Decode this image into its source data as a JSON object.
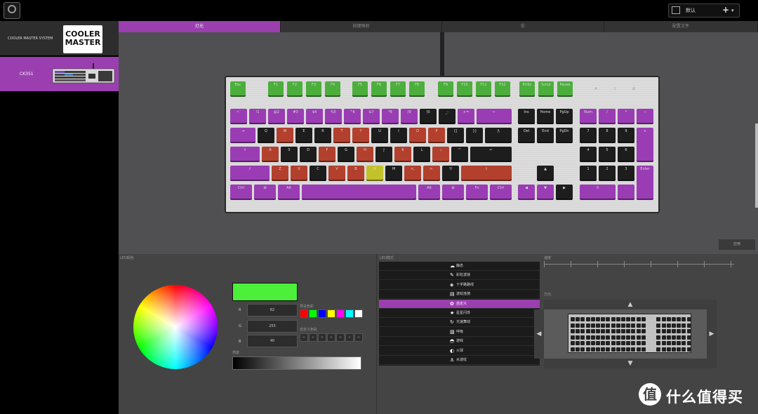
{
  "topbar": {
    "app_icon": "cooler-master-app-icon",
    "profile": {
      "name": "默认",
      "add": "+",
      "caret": "▾",
      "icon": "image-icon"
    }
  },
  "sidebar": {
    "brand_label": "COOLER MASTER SYSTEM",
    "logo_text": "COOLER MASTER",
    "device_label": "CK351"
  },
  "tabs": [
    "灯光",
    "按键映射",
    "宏",
    "配置文件"
  ],
  "keyboard": {
    "row_fn": [
      [
        "Esc",
        "g"
      ],
      [
        "F1",
        "g"
      ],
      [
        "F2",
        "g"
      ],
      [
        "F3",
        "g"
      ],
      [
        "F4",
        "g"
      ],
      [
        "F5",
        "g"
      ],
      [
        "F6",
        "g"
      ],
      [
        "F7",
        "g"
      ],
      [
        "F8",
        "g"
      ],
      [
        "F9",
        "g"
      ],
      [
        "F10",
        "g"
      ],
      [
        "F11",
        "g"
      ],
      [
        "F12",
        "g"
      ],
      [
        "PrtSc",
        "g"
      ],
      [
        "ScrLk",
        "g"
      ],
      [
        "Pause",
        "g"
      ]
    ],
    "row_num": [
      [
        "~`",
        "p"
      ],
      [
        "!1",
        "p"
      ],
      [
        "@2",
        "p"
      ],
      [
        "#3",
        "p"
      ],
      [
        "$4",
        "p"
      ],
      [
        "%5",
        "p"
      ],
      [
        "^6",
        "p"
      ],
      [
        "&7",
        "p"
      ],
      [
        "*8",
        "p"
      ],
      [
        "(9",
        "p"
      ],
      [
        ")0",
        "k"
      ],
      [
        "_-",
        "k"
      ],
      [
        "+=",
        "p"
      ],
      [
        "←",
        "p"
      ],
      [
        "Ins",
        "k"
      ],
      [
        "Home",
        "k"
      ],
      [
        "PgUp",
        "k"
      ],
      [
        "Num",
        "p"
      ],
      [
        "/",
        "p"
      ],
      [
        "*",
        "p"
      ],
      [
        "−",
        "p"
      ]
    ],
    "row_q": [
      [
        "⇥",
        "p"
      ],
      [
        "Q",
        "k"
      ],
      [
        "W",
        "r"
      ],
      [
        "E",
        "k"
      ],
      [
        "R",
        "k"
      ],
      [
        "T",
        "r"
      ],
      [
        "Y",
        "r"
      ],
      [
        "U",
        "k"
      ],
      [
        "I",
        "k"
      ],
      [
        "O",
        "r"
      ],
      [
        "P",
        "r"
      ],
      [
        "{[",
        "k"
      ],
      [
        "}]",
        "k"
      ],
      [
        "|\\",
        "k"
      ],
      [
        "Del",
        "k"
      ],
      [
        "End",
        "k"
      ],
      [
        "PgDn",
        "k"
      ],
      [
        "7",
        "k"
      ],
      [
        "8",
        "k"
      ],
      [
        "9",
        "k"
      ],
      [
        "+",
        "p"
      ]
    ],
    "row_a": [
      [
        "⇪",
        "p"
      ],
      [
        "A",
        "r"
      ],
      [
        "S",
        "k"
      ],
      [
        "D",
        "k"
      ],
      [
        "F",
        "r"
      ],
      [
        "G",
        "k"
      ],
      [
        "H",
        "r"
      ],
      [
        "J",
        "k"
      ],
      [
        "K",
        "r"
      ],
      [
        "L",
        "k"
      ],
      [
        ":;",
        "r"
      ],
      [
        "\"'",
        "k"
      ],
      [
        "↵",
        "k"
      ],
      [
        "4",
        "k"
      ],
      [
        "5",
        "k"
      ],
      [
        "6",
        "k"
      ]
    ],
    "row_z": [
      [
        "⇧",
        "p"
      ],
      [
        "Z",
        "r"
      ],
      [
        "X",
        "r"
      ],
      [
        "C",
        "k"
      ],
      [
        "V",
        "r"
      ],
      [
        "B",
        "r"
      ],
      [
        "N",
        "y"
      ],
      [
        "M",
        "k"
      ],
      [
        "<,",
        "r"
      ],
      [
        ">.",
        "r"
      ],
      [
        "?/",
        "k"
      ],
      [
        "⇧",
        "r"
      ],
      [
        "▲",
        "k"
      ],
      [
        "1",
        "k"
      ],
      [
        "2",
        "k"
      ],
      [
        "3",
        "k"
      ],
      [
        "Enter",
        "p"
      ]
    ],
    "row_sp": [
      [
        "Ctrl",
        "p"
      ],
      [
        "⊞",
        "p"
      ],
      [
        "Alt",
        "p"
      ],
      [
        "",
        "p"
      ],
      [
        "Alt",
        "p"
      ],
      [
        "⊞",
        "p"
      ],
      [
        "Fn",
        "p"
      ],
      [
        "Ctrl",
        "p"
      ],
      [
        "◀",
        "p"
      ],
      [
        "▼",
        "p"
      ],
      [
        "▶",
        "k"
      ],
      [
        "0",
        "p"
      ],
      [
        ".",
        "p"
      ]
    ],
    "led_labels": [
      "A",
      "1",
      "⊞"
    ]
  },
  "apply_button": "应用",
  "color_panel": {
    "label": "LED颜色",
    "current_color": "#4cf03a",
    "r_label": "R",
    "g_label": "G",
    "b_label": "B",
    "r": "82",
    "g": "255",
    "b": "40",
    "preset_label": "预设色彩",
    "presets": [
      "#ff0000",
      "#00ff00",
      "#0000ff",
      "#ffff00",
      "#ff00ff",
      "#00ffff",
      "#ffffff"
    ],
    "custom_label": "自定义色彩",
    "custom_slots": [
      "+",
      "+",
      "+",
      "+",
      "+",
      "+",
      "+"
    ],
    "brightness_label": "亮度"
  },
  "effect_panel": {
    "label": "LED模式",
    "effects": [
      {
        "icon": "static-icon",
        "glyph": "☁",
        "name": "静态"
      },
      {
        "icon": "rainbow-icon",
        "glyph": "✎",
        "name": "彩虹波浪"
      },
      {
        "icon": "crosshair-icon",
        "glyph": "◈",
        "name": "十字路路线"
      },
      {
        "icon": "ripple-icon",
        "glyph": "▤",
        "name": "波纹涟漪"
      },
      {
        "icon": "custom-icon",
        "glyph": "✿",
        "name": "自定义",
        "active": true
      },
      {
        "icon": "star-icon",
        "glyph": "★",
        "name": "星星闪烁"
      },
      {
        "icon": "reactive-icon",
        "glyph": "↻",
        "name": "光速舞动"
      },
      {
        "icon": "breathing-icon",
        "glyph": "▧",
        "name": "呼吸"
      },
      {
        "icon": "game-icon",
        "glyph": "◓",
        "name": "游戏"
      },
      {
        "icon": "fireball-icon",
        "glyph": "◐",
        "name": "火球"
      },
      {
        "icon": "water-icon",
        "glyph": "⚓",
        "name": "水波纹"
      }
    ]
  },
  "speed_panel": {
    "label": "速度",
    "direction_label": "方向",
    "arrows": {
      "up": "▲",
      "down": "▼",
      "left": "◀",
      "right": "▶"
    }
  },
  "watermark": {
    "logo": "值",
    "text": "什么值得买"
  }
}
